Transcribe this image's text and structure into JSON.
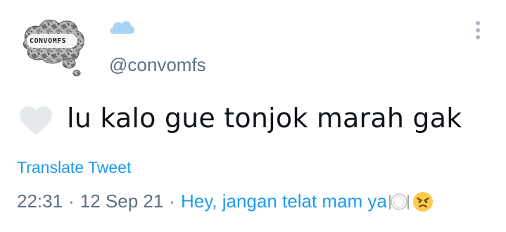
{
  "author": {
    "avatar_text": "CONVOMFS",
    "name_emoji": "cloud-icon",
    "handle": "@convomfs"
  },
  "tweet": {
    "leading_emoji": "white-heart-icon",
    "text": "lu kalo gue tonjok marah gak",
    "translate_label": "Translate Tweet",
    "time": "22:31",
    "date": "12 Sep 21",
    "separator": "·",
    "source": "Hey, jangan telat mam ya",
    "source_emojis": [
      "fork-knife-plate-icon",
      "angry-face-icon"
    ]
  },
  "colors": {
    "link": "#1d9bf0",
    "secondary_text": "#5b7083",
    "primary_text": "#0f1419"
  }
}
